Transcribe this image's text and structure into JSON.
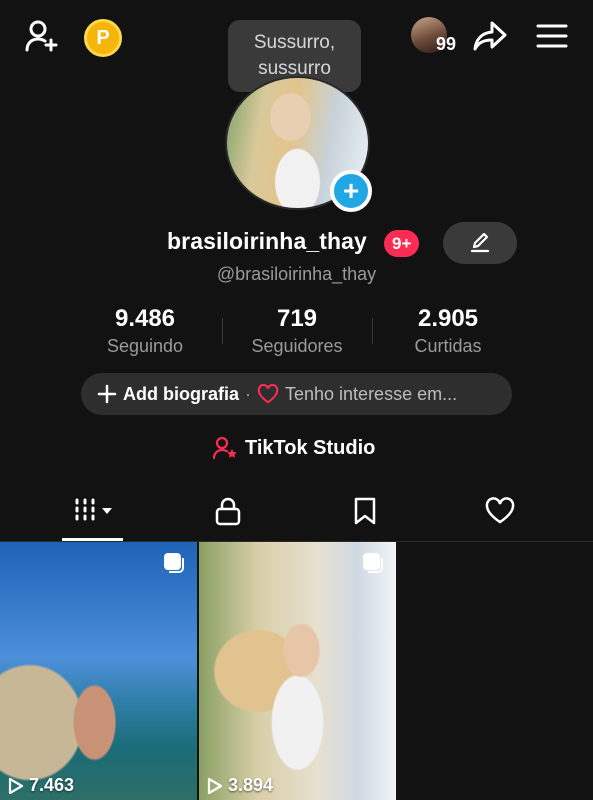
{
  "header": {
    "tooltip_text": "Sussurro,\nsussurro",
    "premium_badge": "P",
    "visitors_count": "99"
  },
  "profile": {
    "username": "brasiloirinha_thay",
    "notification_badge": "9+",
    "handle": "@brasiloirinha_thay"
  },
  "stats": [
    {
      "value": "9.486",
      "label": "Seguindo"
    },
    {
      "value": "719",
      "label": "Seguidores"
    },
    {
      "value": "2.905",
      "label": "Curtidas"
    }
  ],
  "bio": {
    "add_label": "Add biografia",
    "separator": "·",
    "interest_label": "Tenho interesse em..."
  },
  "studio": {
    "label": "TikTok Studio"
  },
  "tabs": [
    "videos-grid",
    "private",
    "saved",
    "liked"
  ],
  "videos": [
    {
      "views": "7.463"
    },
    {
      "views": "3.894"
    }
  ],
  "colors": {
    "background": "#121212",
    "accent_red": "#fe2c55",
    "accent_blue": "#22a7e5",
    "premium_gold": "#f5b50a"
  }
}
